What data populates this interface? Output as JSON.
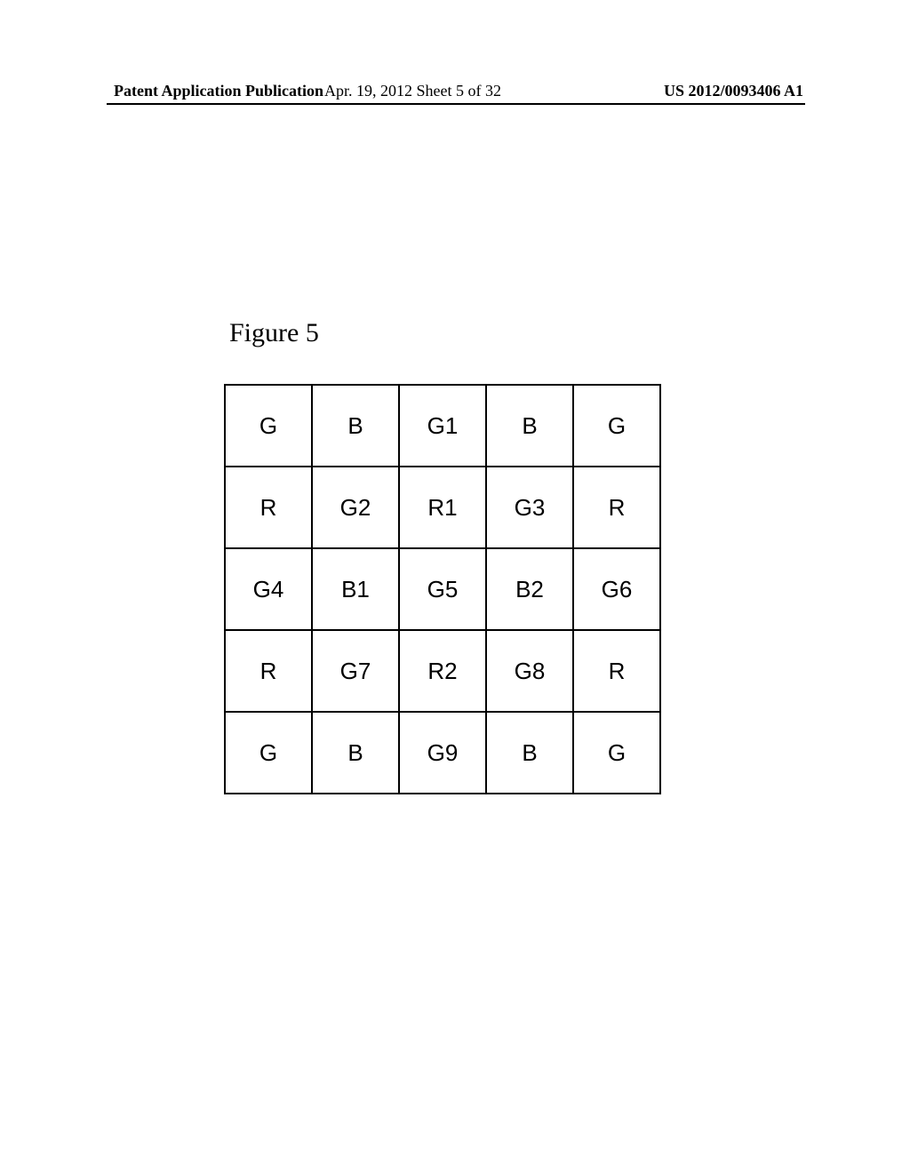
{
  "header": {
    "left": "Patent Application Publication",
    "center": "Apr. 19, 2012  Sheet 5 of 32",
    "right": "US 2012/0093406 A1"
  },
  "figure_label": "Figure 5",
  "grid": {
    "rows": [
      [
        "G",
        "B",
        "G1",
        "B",
        "G"
      ],
      [
        "R",
        "G2",
        "R1",
        "G3",
        "R"
      ],
      [
        "G4",
        "B1",
        "G5",
        "B2",
        "G6"
      ],
      [
        "R",
        "G7",
        "R2",
        "G8",
        "R"
      ],
      [
        "G",
        "B",
        "G9",
        "B",
        "G"
      ]
    ]
  }
}
